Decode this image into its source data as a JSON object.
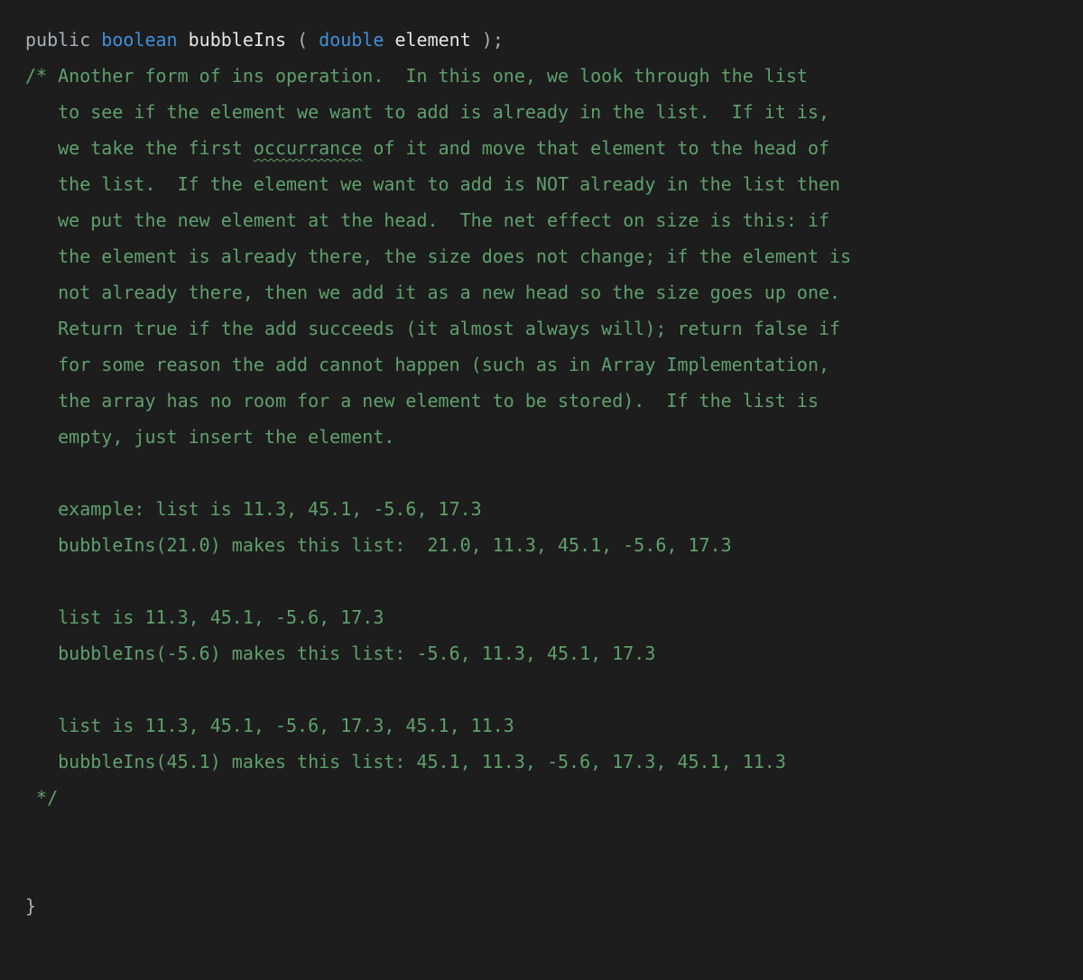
{
  "sig": {
    "public": "public",
    "boolean": "boolean",
    "name": "bubbleIns",
    "lparen": "(",
    "double": "double",
    "param": "element",
    "rparen": ")",
    "semi": ";"
  },
  "comment": {
    "open": "/* ",
    "close": " */",
    "l1a": "Another form of ins operation.  In this one, we look through the list",
    "l2": "   to see if the element we want to add is already in the list.  If it is,",
    "l3a": "   we take the first ",
    "squiggle": "occurrance",
    "l3b": " of it and move that element to the head of",
    "l4": "   the list.  If the element we want to add is NOT already in the list then",
    "l5": "   we put the new element at the head.  The net effect on size is this: if",
    "l6": "   the element is already there, the size does not change; if the element is",
    "l7": "   not already there, then we add it as a new head so the size goes up one.",
    "l8": "   Return true if the add succeeds (it almost always will); return false if",
    "l9": "   for some reason the add cannot happen (such as in Array Implementation,",
    "l10": "   the array has no room for a new element to be stored).  If the list is",
    "l11": "   empty, just insert the element.",
    "blank": "",
    "l12": "   example: list is 11.3, 45.1, -5.6, 17.3",
    "l13": "   bubbleIns(21.0) makes this list:  21.0, 11.3, 45.1, -5.6, 17.3",
    "l14": "   list is 11.3, 45.1, -5.6, 17.3",
    "l15": "   bubbleIns(-5.6) makes this list: -5.6, 11.3, 45.1, 17.3",
    "l16": "   list is 11.3, 45.1, -5.6, 17.3, 45.1, 11.3",
    "l17": "   bubbleIns(45.1) makes this list: 45.1, 11.3, -5.6, 17.3, 45.1, 11.3"
  },
  "closeBrace": "}"
}
